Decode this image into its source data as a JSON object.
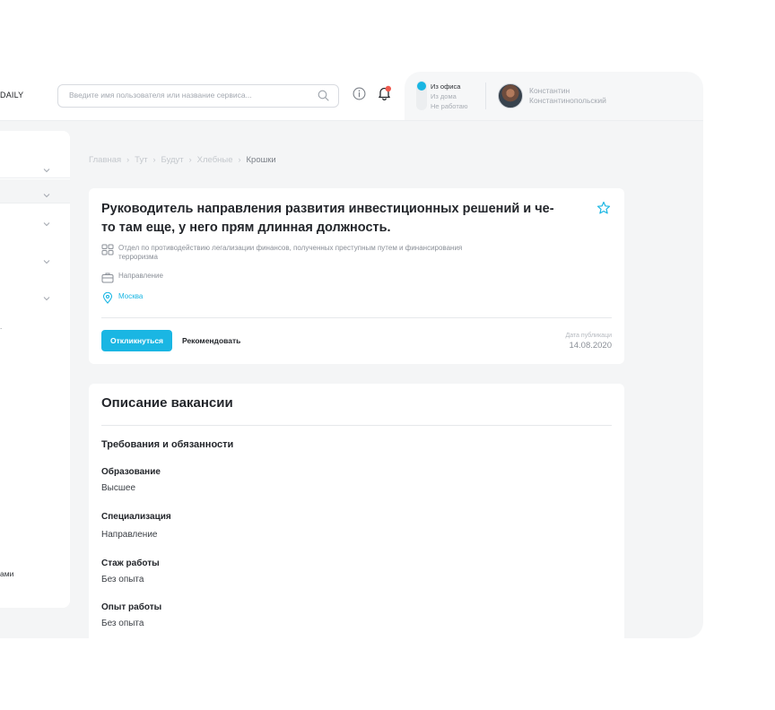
{
  "colors": {
    "accent": "#1ab6e3",
    "notification": "#ef5a4f",
    "background": "#f4f5f6"
  },
  "header": {
    "logo_text": "DAILY",
    "search": {
      "placeholder": "Введите имя пользователя или название сервиса...",
      "value": ""
    },
    "icons": [
      "search-icon",
      "info-icon",
      "bell-icon"
    ],
    "work_status": {
      "options": [
        "Из офиса",
        "Из дома",
        "Не работаю"
      ],
      "selected": "Из офиса"
    },
    "user": {
      "first_name": "Константин",
      "last_name": "Константинопольский"
    }
  },
  "sidebar": {
    "partial_text": "ами",
    "dot_text": "."
  },
  "breadcrumb": {
    "items": [
      "Главная",
      "Тут",
      "Будут",
      "Хлебные",
      "Крошки"
    ],
    "separator": "›"
  },
  "vacancy": {
    "title": "Руководитель направления развития инвестиционных решений и че-то там еще, у него прям длинная должность.",
    "department": "Отдел по противодействию легализации финансов, полученных преступным путем и финансирования терроризма",
    "direction": "Направление",
    "location": "Москва",
    "apply_label": "Откликнуться",
    "recommend_label": "Рекомендовать",
    "publish_label": "Дата публикаци",
    "publish_date": "14.08.2020"
  },
  "description": {
    "title": "Описание вакансии",
    "section_title": "Требования и обязанности",
    "fields": [
      {
        "label": "Образование",
        "value": "Высшее"
      },
      {
        "label": "Специализация",
        "value": "Направление"
      },
      {
        "label": "Стаж работы",
        "value": "Без опыта"
      },
      {
        "label": "Опыт работы",
        "value": "Без опыта"
      }
    ]
  }
}
